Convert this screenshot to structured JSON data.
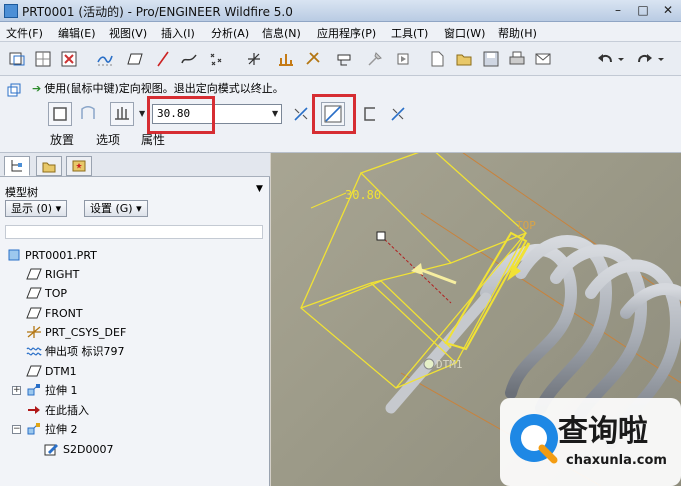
{
  "window": {
    "title": "PRT0001 (活动的) - Pro/ENGINEER Wildfire 5.0",
    "min": "–",
    "max": "□",
    "close": "✕"
  },
  "menu": [
    "文件(F)",
    "编辑(E)",
    "视图(V)",
    "插入(I)",
    "分析(A)",
    "信息(N)",
    "应用程序(P)",
    "工具(T)",
    "窗口(W)",
    "帮助(H)"
  ],
  "dashboard": {
    "message": "使用(鼠标中键)定向视图。退出定向模式以终止。",
    "depth_value": "30.80",
    "tabs": [
      "放置",
      "选项",
      "属性"
    ]
  },
  "model_tree": {
    "title": "模型树",
    "show_button": "显示 (0) ▾",
    "settings_button": "设置 (G) ▾",
    "items": [
      {
        "label": "PRT0001.PRT",
        "icon": "part-icon"
      },
      {
        "label": "RIGHT",
        "icon": "datum-plane-icon"
      },
      {
        "label": "TOP",
        "icon": "datum-plane-icon"
      },
      {
        "label": "FRONT",
        "icon": "datum-plane-icon"
      },
      {
        "label": "PRT_CSYS_DEF",
        "icon": "csys-icon"
      },
      {
        "label": "伸出项 标识797",
        "icon": "protrusion-icon"
      },
      {
        "label": "DTM1",
        "icon": "datum-plane-icon"
      },
      {
        "label": "拉伸 1",
        "icon": "extrude-icon"
      },
      {
        "label": "在此插入",
        "icon": "insert-here-icon"
      },
      {
        "label": "拉伸 2",
        "icon": "extrude-icon"
      },
      {
        "label": "S2D0007",
        "icon": "sketch-icon"
      }
    ]
  },
  "viewport": {
    "dimension_label": "30.80",
    "top_label": "TOP",
    "dtm_label": "DTM1"
  },
  "watermark": {
    "text": "查询啦",
    "url": "chaxunla.com"
  },
  "colors": {
    "highlight_red": "#d62d32",
    "sketch_yellow": "#f1e234",
    "spring_gray": "#a9aeb6"
  }
}
